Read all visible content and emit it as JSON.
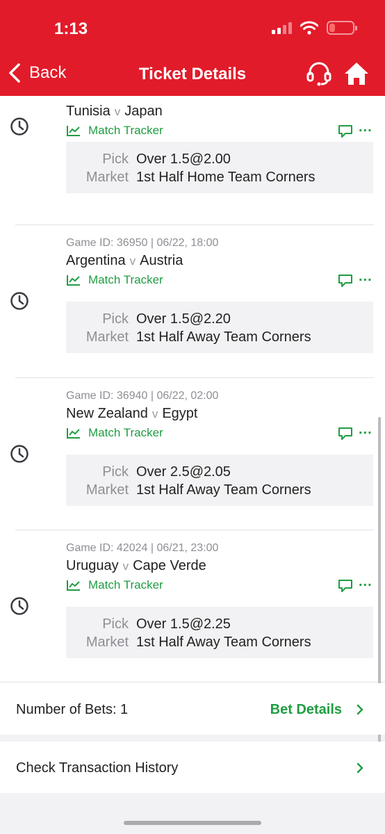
{
  "status": {
    "time": "1:13"
  },
  "nav": {
    "back_label": "Back",
    "title": "Ticket Details"
  },
  "bets": [
    {
      "home": "Tunisia",
      "away": "Japan",
      "tracker_label": "Match Tracker",
      "pick_label": "Pick",
      "pick": "Over 1.5@2.00",
      "market_label": "Market",
      "market": "1st Half Home Team Corners"
    },
    {
      "game_info": "Game ID: 36950 | 06/22, 18:00",
      "home": "Argentina",
      "away": "Austria",
      "tracker_label": "Match Tracker",
      "pick_label": "Pick",
      "pick": "Over 1.5@2.20",
      "market_label": "Market",
      "market": "1st Half Away Team Corners"
    },
    {
      "game_info": "Game ID: 36940 | 06/22, 02:00",
      "home": "New Zealand",
      "away": "Egypt",
      "tracker_label": "Match Tracker",
      "pick_label": "Pick",
      "pick": "Over 2.5@2.05",
      "market_label": "Market",
      "market": "1st Half Away Team Corners"
    },
    {
      "game_info": "Game ID: 42024 | 06/21, 23:00",
      "home": "Uruguay",
      "away": "Cape Verde",
      "tracker_label": "Match Tracker",
      "pick_label": "Pick",
      "pick": "Over 1.5@2.25",
      "market_label": "Market",
      "market": "1st Half Away Team Corners"
    }
  ],
  "vs_label": "v",
  "more_label": "...",
  "footer": {
    "number_of_bets": "Number of Bets: 1",
    "bet_details_link": "Bet Details",
    "transaction_history": "Check Transaction History"
  },
  "colors": {
    "brand_red": "#e21b2a",
    "accent_green": "#1f9d42"
  },
  "icons": {
    "back": "chevron-left-icon",
    "support": "headset-icon",
    "home": "home-icon",
    "clock": "clock-icon",
    "tracker": "line-chart-icon",
    "chat": "chat-bubble-icon",
    "chevron": "chevron-right-icon"
  }
}
